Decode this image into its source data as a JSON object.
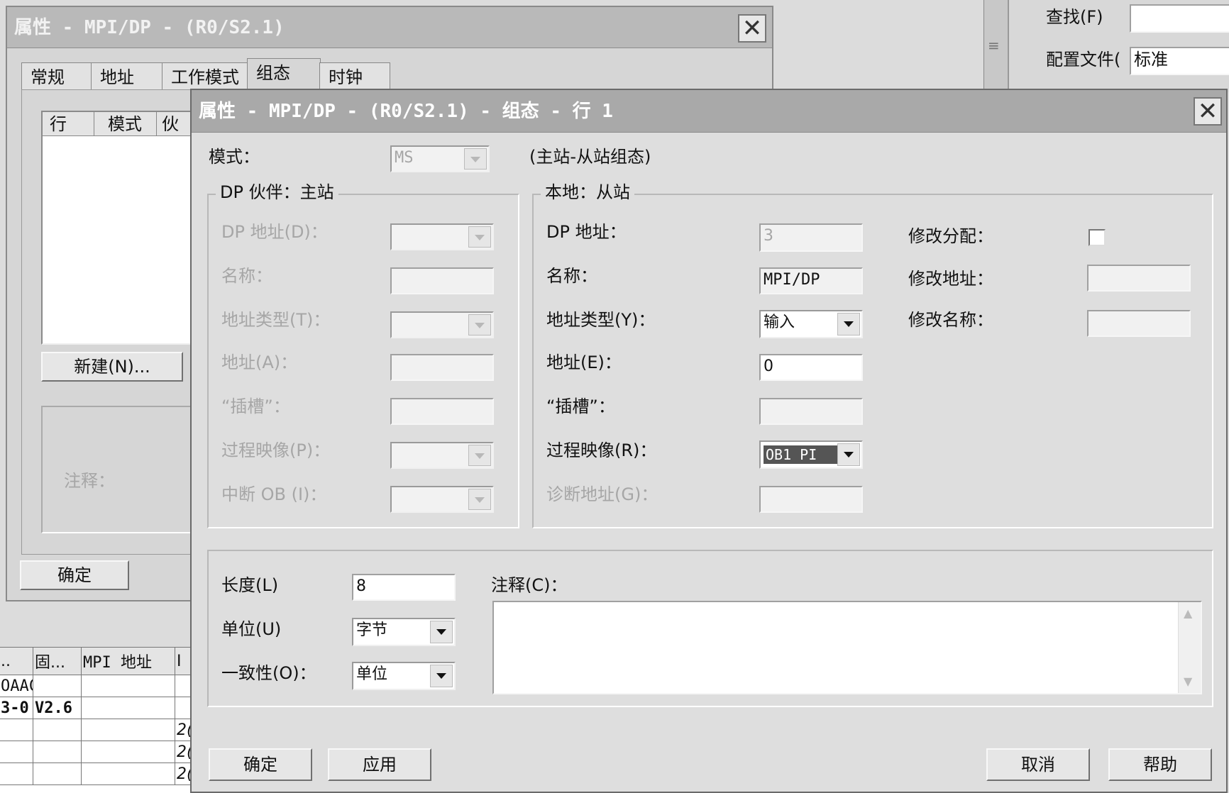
{
  "background_window": {
    "title": "属性 - MPI/DP - (R0/S2.1)",
    "tabs": [
      "常规",
      "地址",
      "工作模式",
      "组态",
      "时钟"
    ],
    "columns": [
      "行",
      "模式",
      "伙"
    ],
    "new_button": "新建(N)...",
    "comment_label": "注释：",
    "ok_button": "确定"
  },
  "sidebar": {
    "find_label": "查找(F)",
    "profile_label": "配置文件(",
    "profile_value": "标准"
  },
  "bottom_table": {
    "headers": [
      "..",
      "固...",
      "MPI 地址",
      "I"
    ],
    "rows": [
      [
        "OAAC",
        "",
        "",
        ""
      ],
      [
        "3-0",
        "V2.6",
        "",
        ""
      ],
      [
        "",
        "",
        "",
        "2("
      ],
      [
        "",
        "",
        "",
        "2("
      ],
      [
        "",
        "",
        "",
        "2("
      ]
    ]
  },
  "dialog": {
    "title": "属性 - MPI/DP - (R0/S2.1) - 组态 - 行 1",
    "mode_label": "模式：",
    "mode_value": "MS",
    "mode_desc": "(主站-从站组态)",
    "partner": {
      "legend": "DP 伙伴：主站",
      "dp_address_label": "DP 地址(D)：",
      "name_label": "名称：",
      "address_type_label": "地址类型(T)：",
      "address_label": "地址(A)：",
      "slot_label": "“插槽”：",
      "process_image_label": "过程映像(P)：",
      "interrupt_ob_label": "中断 OB (I)："
    },
    "local": {
      "legend": "本地：从站",
      "dp_address_label": "DP 地址：",
      "dp_address_value": "3",
      "name_label": "名称：",
      "name_value": "MPI/DP",
      "address_type_label": "地址类型(Y)：",
      "address_type_value": "输入",
      "address_label": "地址(E)：",
      "address_value": "0",
      "slot_label": "“插槽”：",
      "process_image_label": "过程映像(R)：",
      "process_image_value": "OB1 PI",
      "diag_address_label": "诊断地址(G)：",
      "mod_assign_label": "修改分配：",
      "mod_address_label": "修改地址：",
      "mod_name_label": "修改名称："
    },
    "length_label": "长度(L)",
    "length_value": "8",
    "unit_label": "单位(U)",
    "unit_value": "字节",
    "consistency_label": "一致性(O)：",
    "consistency_value": "单位",
    "comment_label": "注释(C)：",
    "buttons": {
      "ok": "确定",
      "apply": "应用",
      "cancel": "取消",
      "help": "帮助"
    }
  }
}
